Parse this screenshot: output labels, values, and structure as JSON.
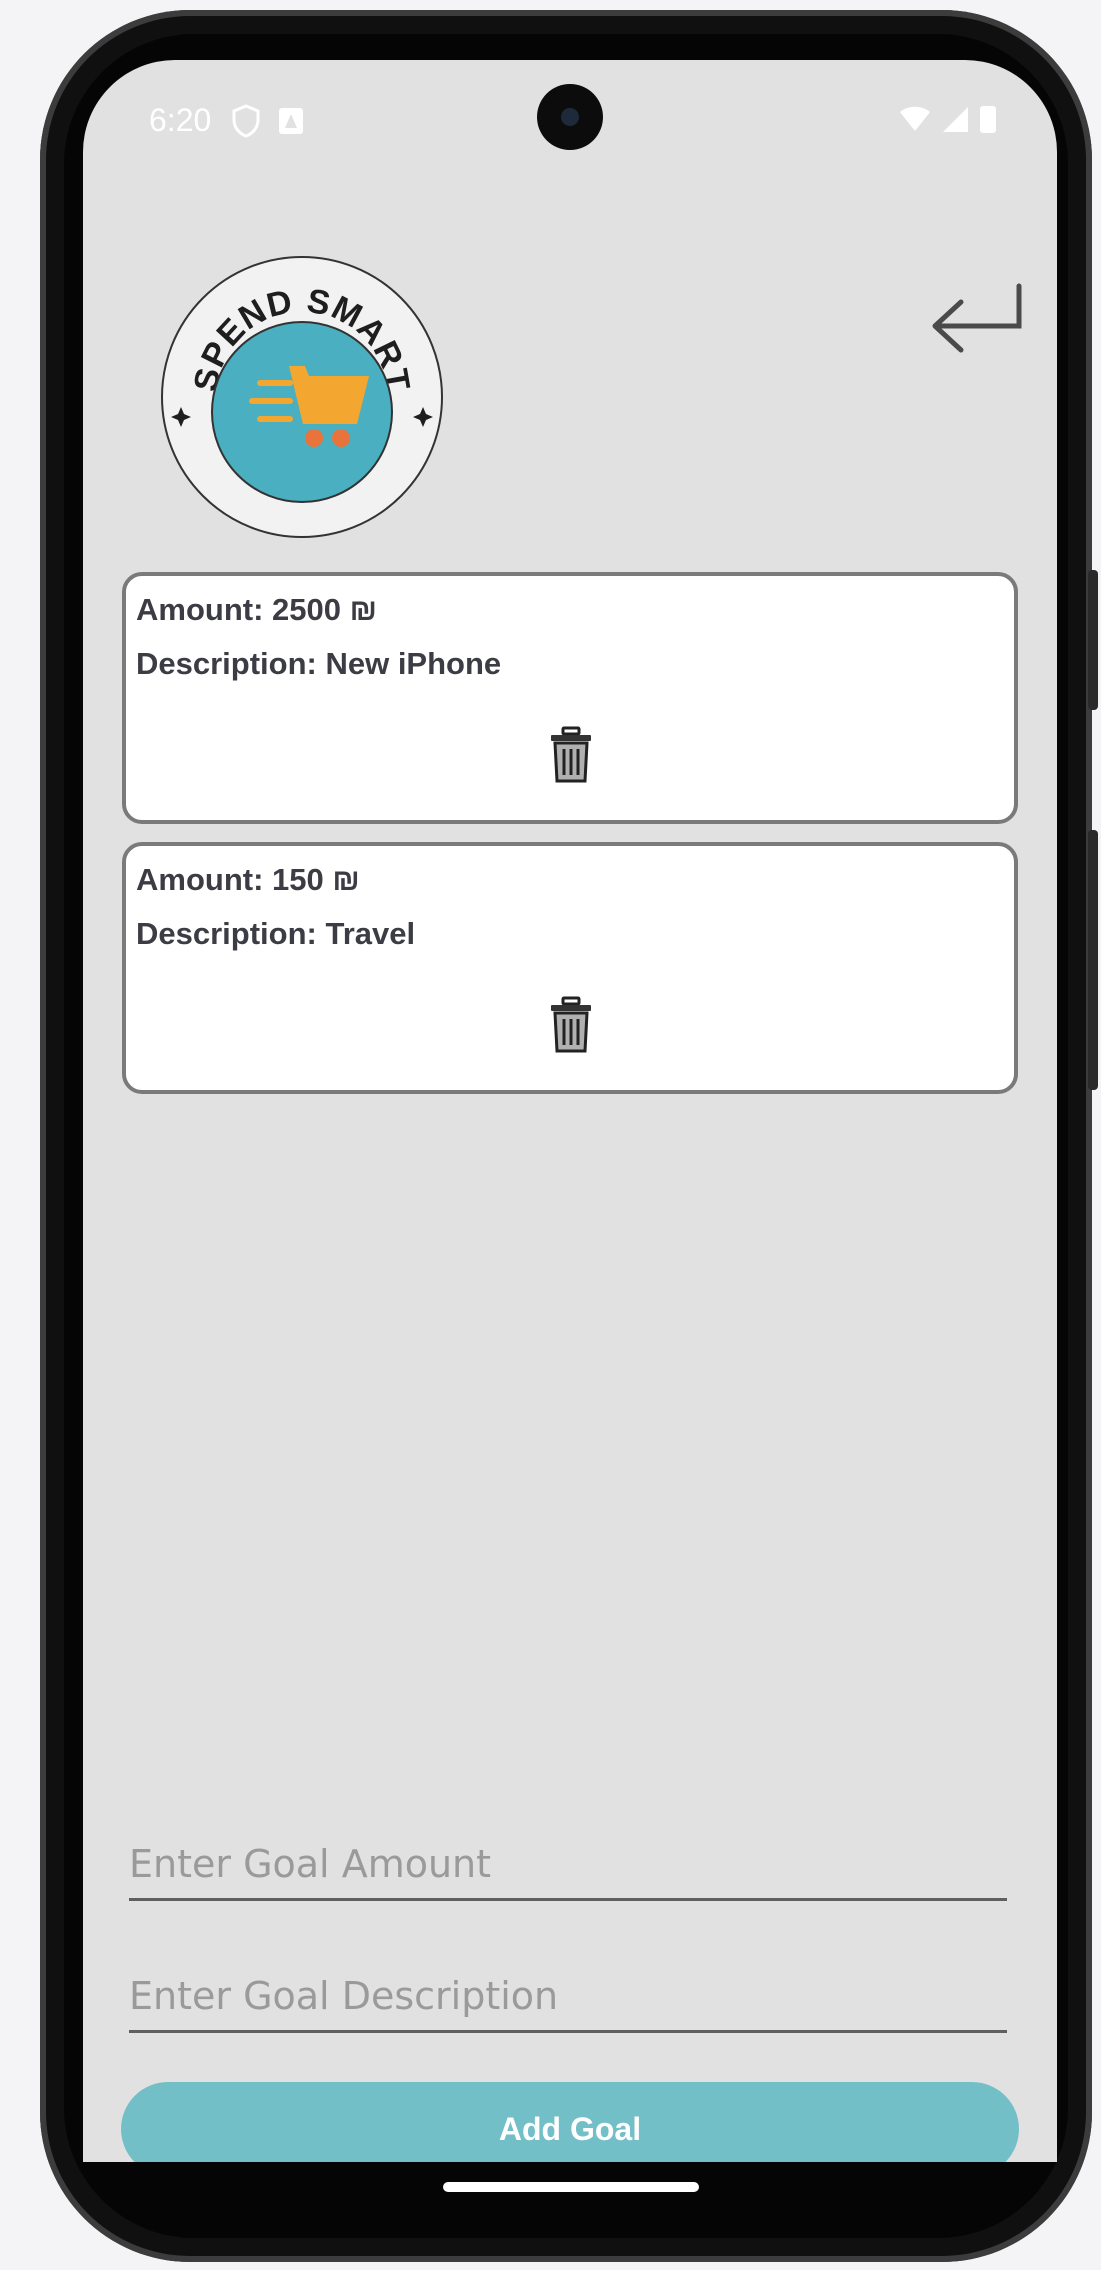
{
  "status_bar": {
    "time": "6:20"
  },
  "logo": {
    "text": "SPEND SMART",
    "ring_color": "#333333",
    "cart_bg_color": "#4aafc0",
    "cart_color": "#f3a731",
    "wheel_color": "#e8743b"
  },
  "goals": [
    {
      "amount": "Amount: 2500 ₪",
      "description": "Description: New iPhone"
    },
    {
      "amount": "Amount: 150 ₪",
      "description": "Description: Travel"
    }
  ],
  "form": {
    "amount_placeholder": "Enter Goal Amount",
    "description_placeholder": "Enter Goal Description",
    "add_button_label": "Add Goal"
  },
  "icons": {
    "back": "return-arrow-icon",
    "delete": "trash-icon"
  },
  "colors": {
    "background": "#e1e1e1",
    "button": "#73bfc7",
    "card_border": "#7a7a7a"
  }
}
